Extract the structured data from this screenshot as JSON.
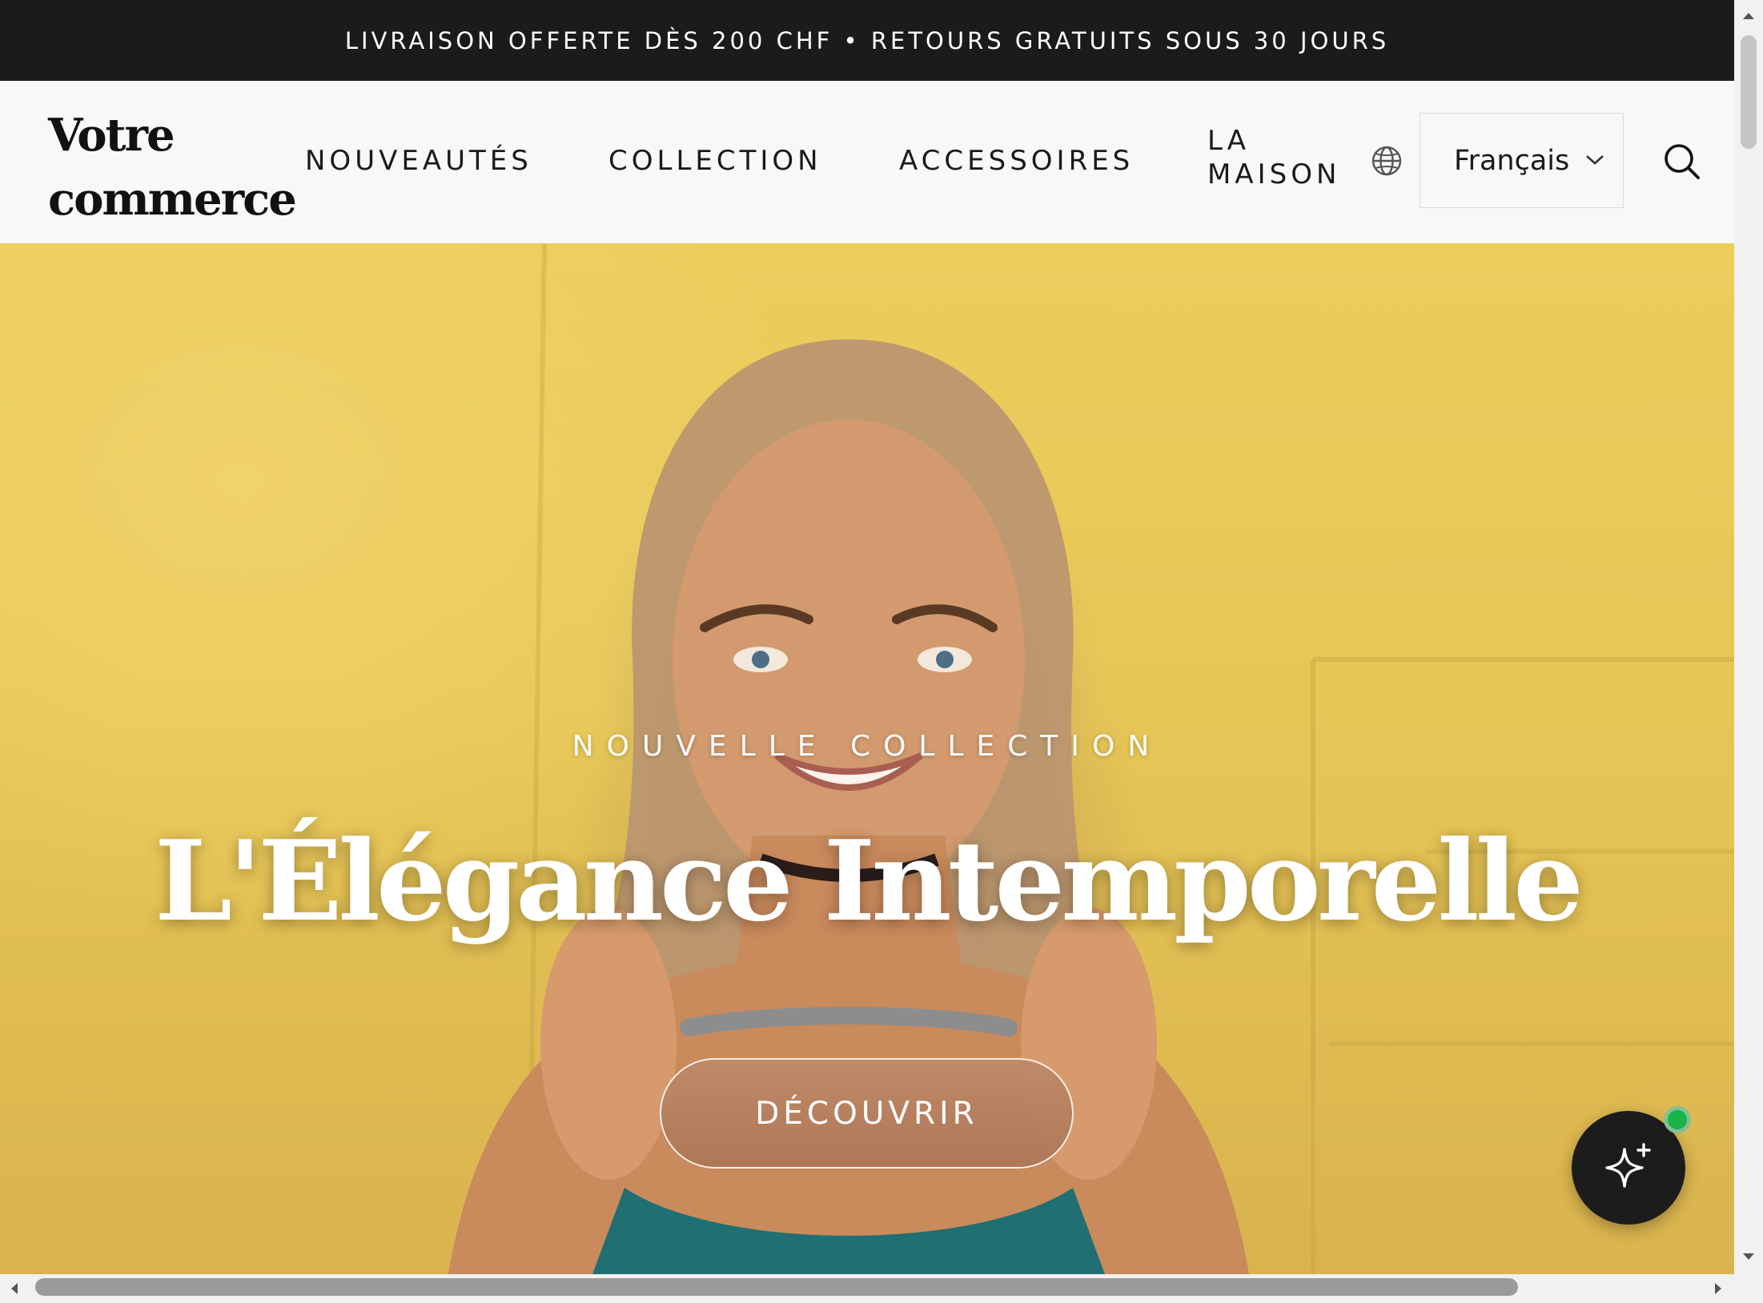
{
  "announcement": {
    "text": "LIVRAISON OFFERTE DÈS 200 CHF • RETOURS GRATUITS SOUS 30 JOURS"
  },
  "header": {
    "logo_line1": "Votre",
    "logo_line2": "commerce",
    "nav": {
      "item1": "NOUVEAUTÉS",
      "item2": "COLLECTION",
      "item3": "ACCESSOIRES",
      "item4_line1": "LA",
      "item4_line2": "MAISON"
    },
    "language": {
      "selected": "Français",
      "icon": "globe-icon"
    },
    "search_icon": "search-icon"
  },
  "hero": {
    "eyebrow": "NOUVELLE COLLECTION",
    "title": "L'Élégance Intemporelle",
    "cta": "DÉCOUVRIR"
  },
  "assistant": {
    "icon": "sparkle-icon",
    "status": "online",
    "status_color": "#19b34a"
  },
  "colors": {
    "topbar": "#1b1b1b",
    "header_bg": "#f8f8f8",
    "hero_bg": "#e7c656",
    "cta_bg": "#b77f5e",
    "assistant_bg": "#1c1c1c"
  }
}
